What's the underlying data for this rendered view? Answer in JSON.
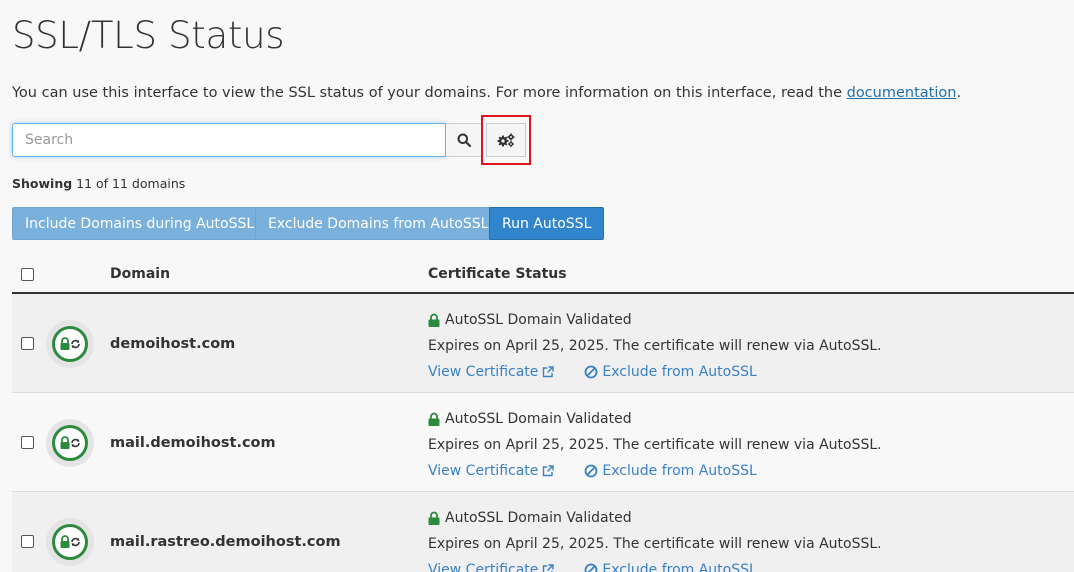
{
  "page": {
    "title": "SSL/TLS Status",
    "intro_text": "You can use this interface to view the SSL status of your domains. For more information on this interface, read the ",
    "intro_link": "documentation",
    "intro_end": "."
  },
  "search": {
    "placeholder": "Search",
    "value": ""
  },
  "showing": {
    "label": "Showing",
    "text": "11 of 11 domains"
  },
  "buttons": {
    "include": "Include Domains during AutoSSL",
    "exclude": "Exclude Domains from AutoSSL",
    "run": "Run AutoSSL"
  },
  "table": {
    "headers": {
      "domain": "Domain",
      "status": "Certificate Status"
    },
    "rows": [
      {
        "domain": "demoihost.com",
        "status": "AutoSSL Domain Validated",
        "expires": "Expires on April 25, 2025. The certificate will renew via AutoSSL.",
        "view": "View Certificate",
        "exclude": "Exclude from AutoSSL"
      },
      {
        "domain": "mail.demoihost.com",
        "status": "AutoSSL Domain Validated",
        "expires": "Expires on April 25, 2025. The certificate will renew via AutoSSL.",
        "view": "View Certificate",
        "exclude": "Exclude from AutoSSL"
      },
      {
        "domain": "mail.rastreo.demoihost.com",
        "status": "AutoSSL Domain Validated",
        "expires": "Expires on April 25, 2025. The certificate will renew via AutoSSL.",
        "view": "View Certificate",
        "exclude": "Exclude from AutoSSL"
      }
    ]
  },
  "colors": {
    "accent": "#3185cd",
    "success": "#2c8a3f",
    "link": "#3a80c4",
    "highlight": "#e0141e"
  },
  "icons": {
    "search": "search-icon",
    "settings": "gears-icon",
    "lock": "lock-icon",
    "external": "external-link-icon",
    "ban": "ban-icon"
  }
}
